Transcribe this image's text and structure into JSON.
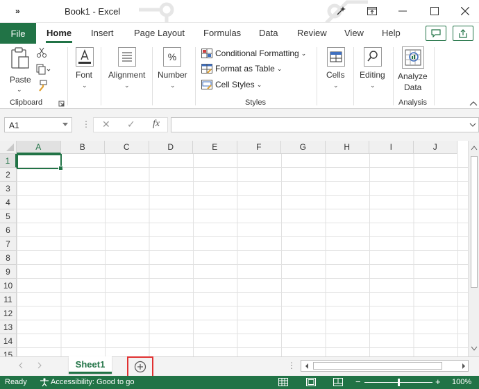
{
  "titlebar": {
    "title": "Book1  -  Excel",
    "more_glyph": "»"
  },
  "tabs": {
    "file": "File",
    "items": [
      "Home",
      "Insert",
      "Page Layout",
      "Formulas",
      "Data",
      "Review",
      "View",
      "Help"
    ],
    "active": "Home"
  },
  "ribbon": {
    "clipboard": {
      "paste": "Paste",
      "label": "Clipboard"
    },
    "font": {
      "label": "Font"
    },
    "alignment": {
      "label": "Alignment"
    },
    "number": {
      "label": "Number"
    },
    "styles": {
      "conditional_formatting": "Conditional Formatting",
      "format_as_table": "Format as Table",
      "cell_styles": "Cell Styles",
      "label": "Styles"
    },
    "cells": {
      "label": "Cells"
    },
    "editing": {
      "label": "Editing"
    },
    "analyze": {
      "line1": "Analyze",
      "line2": "Data",
      "label": "Analysis"
    }
  },
  "formula_bar": {
    "name_box": "A1",
    "fx": "fx",
    "value": ""
  },
  "grid": {
    "columns": [
      "A",
      "B",
      "C",
      "D",
      "E",
      "F",
      "G",
      "H",
      "I",
      "J"
    ],
    "rows": [
      "1",
      "2",
      "3",
      "4",
      "5",
      "6",
      "7",
      "8",
      "9",
      "10",
      "11",
      "12",
      "13",
      "14",
      "15"
    ],
    "selected_column": "A",
    "selected_row": "1"
  },
  "sheets": {
    "tabs": [
      "Sheet1"
    ],
    "active": "Sheet1"
  },
  "statusbar": {
    "ready": "Ready",
    "accessibility": "Accessibility: Good to go",
    "zoom_minus": "−",
    "zoom_plus": "+",
    "zoom": "100%"
  },
  "colors": {
    "accent": "#217346",
    "highlight": "#e03030"
  }
}
